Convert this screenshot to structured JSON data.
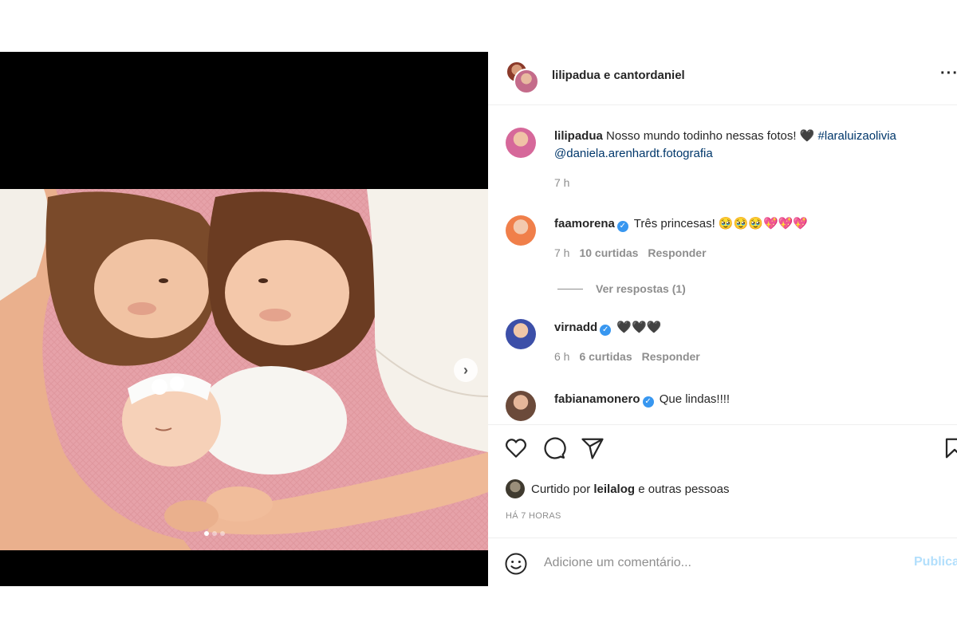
{
  "header": {
    "names": "lilipadua e cantordaniel",
    "more_icon": "more-horizontal-icon",
    "more_glyph": "···"
  },
  "caption": {
    "username": "lilipadua",
    "text": "Nosso mundo todinho nessas fotos! 🖤",
    "hashtag": "#laraluizaolivia",
    "mention": "@daniela.arenhardt.fotografia",
    "time": "7 h"
  },
  "comments": [
    {
      "username": "faamorena",
      "verified": true,
      "text": "Três princesas! 🥹🥹🥹💖💖💖",
      "time": "7 h",
      "likes": "10 curtidas",
      "reply": "Responder",
      "avatar_color": "#f07f4a"
    },
    {
      "username": "virnadd",
      "verified": true,
      "text": "🖤🖤🖤",
      "time": "6 h",
      "likes": "6 curtidas",
      "reply": "Responder",
      "avatar_color": "#3c4fa8"
    },
    {
      "username": "fabianamonero",
      "verified": true,
      "text": "Que lindas!!!!",
      "avatar_color": "#6b4a3a"
    }
  ],
  "view_replies": "Ver respostas (1)",
  "actions": {
    "like_icon": "heart-icon",
    "comment_icon": "comment-icon",
    "share_icon": "share-icon",
    "save_icon": "bookmark-icon"
  },
  "likes": {
    "prefix": "Curtido por",
    "user": "leilalog",
    "suffix": "e outras pessoas"
  },
  "post_time": "HÁ 7 HORAS",
  "add_comment": {
    "placeholder": "Adicione um comentário...",
    "publish": "Publicar"
  },
  "carousel": {
    "slide_count": 3,
    "active_slide": 1,
    "next_glyph": "›"
  },
  "colors": {
    "link": "#00376b",
    "verified": "#3897f0",
    "publish_disabled": "#b2dffc",
    "secondary_text": "#8e8e8e"
  }
}
